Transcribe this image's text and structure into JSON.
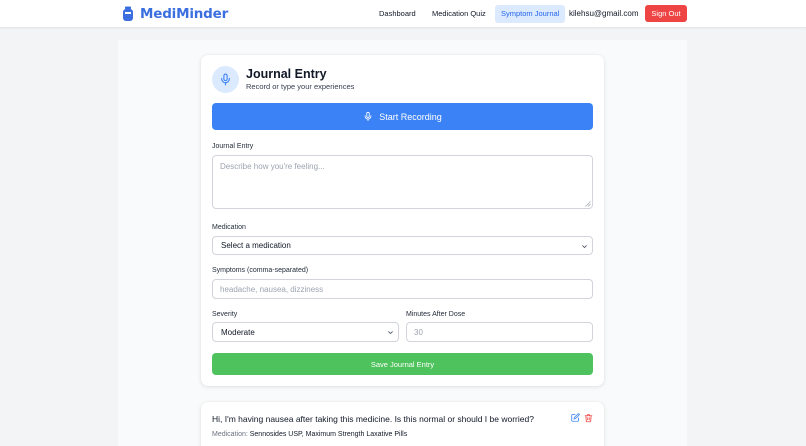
{
  "brand": {
    "name": "MediMinder",
    "icon": "pill-icon",
    "color": "#3b6fe0"
  },
  "nav": {
    "dashboard": "Dashboard",
    "quiz": "Medication Quiz",
    "journal": "Symptom Journal",
    "active": "Symptom Journal",
    "email": "kilehsu@gmail.com",
    "signout": "Sign Out"
  },
  "journal_form": {
    "title": "Journal Entry",
    "subtitle": "Record or type your experiences",
    "header_icon": "microphone-icon",
    "record_button": "Start Recording",
    "entry_label": "Journal Entry",
    "entry_placeholder": "Describe how you're feeling...",
    "medication_label": "Medication",
    "medication_selected": "Select a medication",
    "symptoms_label": "Symptoms (comma-separated)",
    "symptoms_placeholder": "headache, nausea, dizziness",
    "severity_label": "Severity",
    "severity_selected": "Moderate",
    "minutes_label": "Minutes After Dose",
    "minutes_placeholder": "30",
    "save_button": "Save Journal Entry"
  },
  "entries": [
    {
      "text": "Hi, I'm having nausea after taking this medicine. Is this normal or should I be worried?",
      "medication_label": "Medication:",
      "medication": "Sennosides USP, Maximum Strength Laxative Pills"
    }
  ],
  "colors": {
    "primary": "#3b82f6",
    "success": "#4ec25c",
    "danger": "#ef4444",
    "active_nav_bg": "#dbeafe"
  }
}
